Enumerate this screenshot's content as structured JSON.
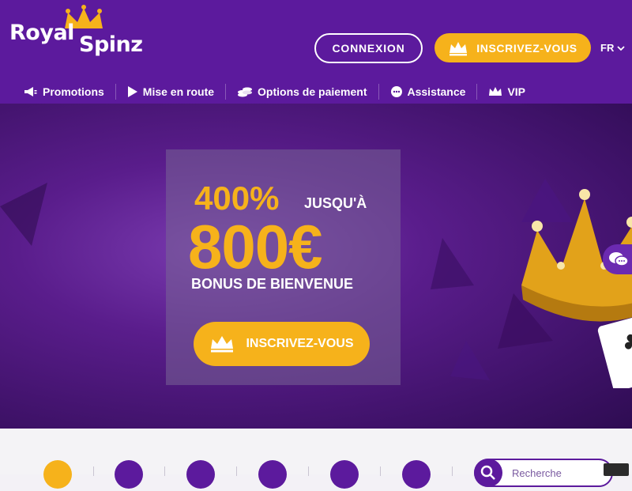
{
  "brand": {
    "part1": "Royal",
    "part2": "Spinz"
  },
  "header": {
    "login_label": "CONNEXION",
    "signup_label": "INSCRIVEZ-VOUS",
    "language": "FR"
  },
  "nav": {
    "items": [
      {
        "label": "Promotions",
        "icon": "megaphone-icon"
      },
      {
        "label": "Mise en route",
        "icon": "play-icon"
      },
      {
        "label": "Options de paiement",
        "icon": "coins-icon"
      },
      {
        "label": "Assistance",
        "icon": "chat-bubble-icon"
      },
      {
        "label": "VIP",
        "icon": "crown-icon"
      }
    ]
  },
  "promo": {
    "percent": "400%",
    "upto": "JUSQU'À",
    "amount": "800€",
    "subtitle": "BONUS DE BIENVENUE",
    "cta_label": "INSCRIVEZ-VOUS"
  },
  "search": {
    "placeholder": "Recherche"
  },
  "colors": {
    "brand_purple": "#5c1a9d",
    "accent_gold": "#f6b21b",
    "white": "#ffffff"
  }
}
